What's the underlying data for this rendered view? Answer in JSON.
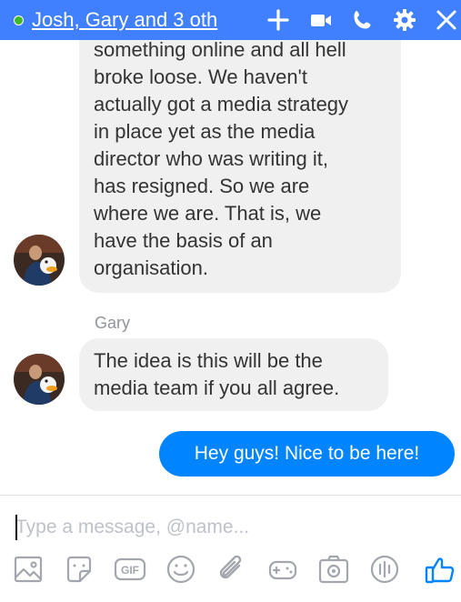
{
  "header": {
    "title": "Josh, Gary and 3 oth",
    "online": true,
    "icons": [
      "plus-icon",
      "video-call-icon",
      "phone-icon",
      "gear-icon",
      "close-icon"
    ]
  },
  "messages": {
    "first_lines": [
      "something online and all hell",
      "broke loose. We haven't",
      "actually got a media strategy",
      "in place yet as the media",
      "director who was writing it,",
      "has resigned. So we are",
      "where we are. That is, we",
      "have the basis of an",
      "organisation."
    ],
    "second_sender": "Gary",
    "second_lines": [
      "The idea is this will be the",
      "media team if you all agree."
    ],
    "outgoing": "Hey guys! Nice to be here!"
  },
  "composer": {
    "placeholder": "Type a message, @name..."
  },
  "toolbar": {
    "gif_label": "GIF",
    "icons": [
      "image-icon",
      "sticker-icon",
      "gif-icon",
      "emoji-icon",
      "attachment-icon",
      "game-icon",
      "camera-icon",
      "voice-clip-icon",
      "like-icon"
    ]
  },
  "colors": {
    "header": "#4080ff",
    "outgoing_bubble": "#0084ff",
    "incoming_bubble": "#f1f0f0",
    "online": "#42b72a"
  }
}
